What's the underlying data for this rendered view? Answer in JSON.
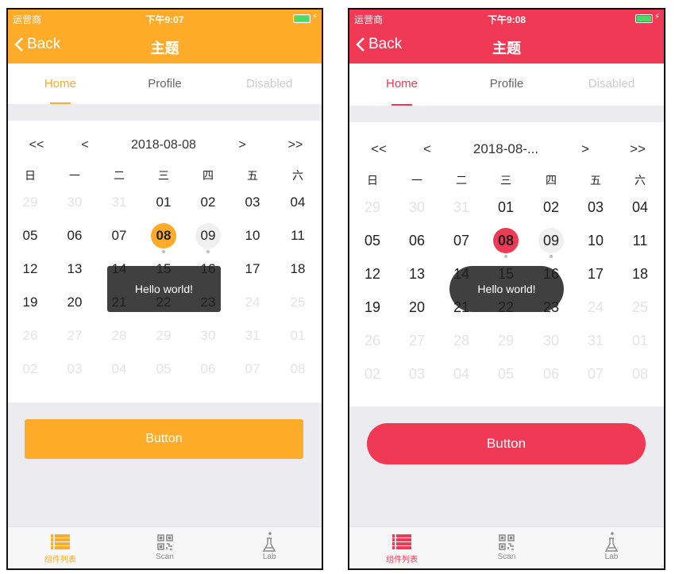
{
  "phones": [
    {
      "accent": "#fdab29",
      "status": {
        "carrier": "运营商",
        "time": "下午9:07"
      },
      "nav": {
        "back": "Back",
        "title": "主题"
      },
      "tabs": [
        {
          "label": "Home",
          "state": "active"
        },
        {
          "label": "Profile",
          "state": "normal"
        },
        {
          "label": "Disabled",
          "state": "disabled"
        }
      ],
      "calendar": {
        "prev_year": "<<",
        "prev_month": "<",
        "title": "2018-08-08",
        "next_month": ">",
        "next_year": ">>"
      },
      "toast": "Hello world!",
      "button": "Button"
    },
    {
      "accent": "#f03a55",
      "status": {
        "carrier": "运营商",
        "time": "下午9:08"
      },
      "nav": {
        "back": "Back",
        "title": "主题"
      },
      "tabs": [
        {
          "label": "Home",
          "state": "active"
        },
        {
          "label": "Profile",
          "state": "normal"
        },
        {
          "label": "Disabled",
          "state": "disabled"
        }
      ],
      "calendar": {
        "prev_year": "<<",
        "prev_month": "<",
        "title": "2018-08-...",
        "next_month": ">",
        "next_year": ">>"
      },
      "toast": "Hello world!",
      "button": "Button"
    }
  ],
  "weekdays": [
    "日",
    "一",
    "二",
    "三",
    "四",
    "五",
    "六"
  ],
  "weeks": [
    [
      "29",
      "30",
      "31",
      "01",
      "02",
      "03",
      "04"
    ],
    [
      "05",
      "06",
      "07",
      "08",
      "09",
      "10",
      "11"
    ],
    [
      "12",
      "13",
      "14",
      "15",
      "16",
      "17",
      "18"
    ],
    [
      "19",
      "20",
      "21",
      "22",
      "23",
      "24",
      "25"
    ],
    [
      "26",
      "27",
      "28",
      "29",
      "30",
      "31",
      "01"
    ],
    [
      "02",
      "03",
      "04",
      "05",
      "06",
      "07",
      "08"
    ]
  ],
  "disabled_cells": "days outside 08-01 to 08-23",
  "selected_day": "08",
  "today_day": "09",
  "marked_days": [
    "08",
    "09"
  ],
  "tabbar": [
    {
      "label": "组件列表",
      "icon": "list-icon",
      "active": true
    },
    {
      "label": "Scan",
      "icon": "qrcode-icon",
      "active": false
    },
    {
      "label": "Lab",
      "icon": "flask-icon",
      "active": false
    }
  ]
}
